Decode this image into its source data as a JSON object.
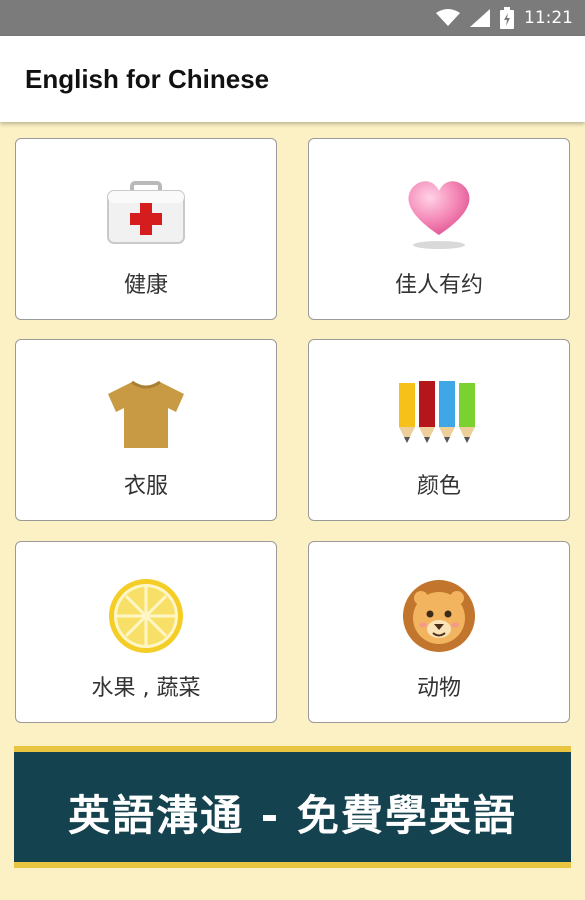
{
  "status_bar": {
    "time": "11:21",
    "icons": [
      "wifi-icon",
      "signal-icon",
      "battery-icon"
    ]
  },
  "app_bar": {
    "title": "English for Chinese"
  },
  "categories": [
    {
      "label": "健康",
      "icon": "first-aid-kit-icon"
    },
    {
      "label": "佳人有约",
      "icon": "heart-icon"
    },
    {
      "label": "衣服",
      "icon": "tshirt-icon"
    },
    {
      "label": "颜色",
      "icon": "colored-pencils-icon"
    },
    {
      "label": "水果 , 蔬菜",
      "icon": "lemon-slice-icon"
    },
    {
      "label": "动物",
      "icon": "lion-icon"
    }
  ],
  "banner": {
    "text": "英語溝通 - 免費學英語"
  },
  "colors": {
    "background": "#fbf1c4",
    "banner": "#14424f",
    "banner_border": "#e9c441"
  }
}
